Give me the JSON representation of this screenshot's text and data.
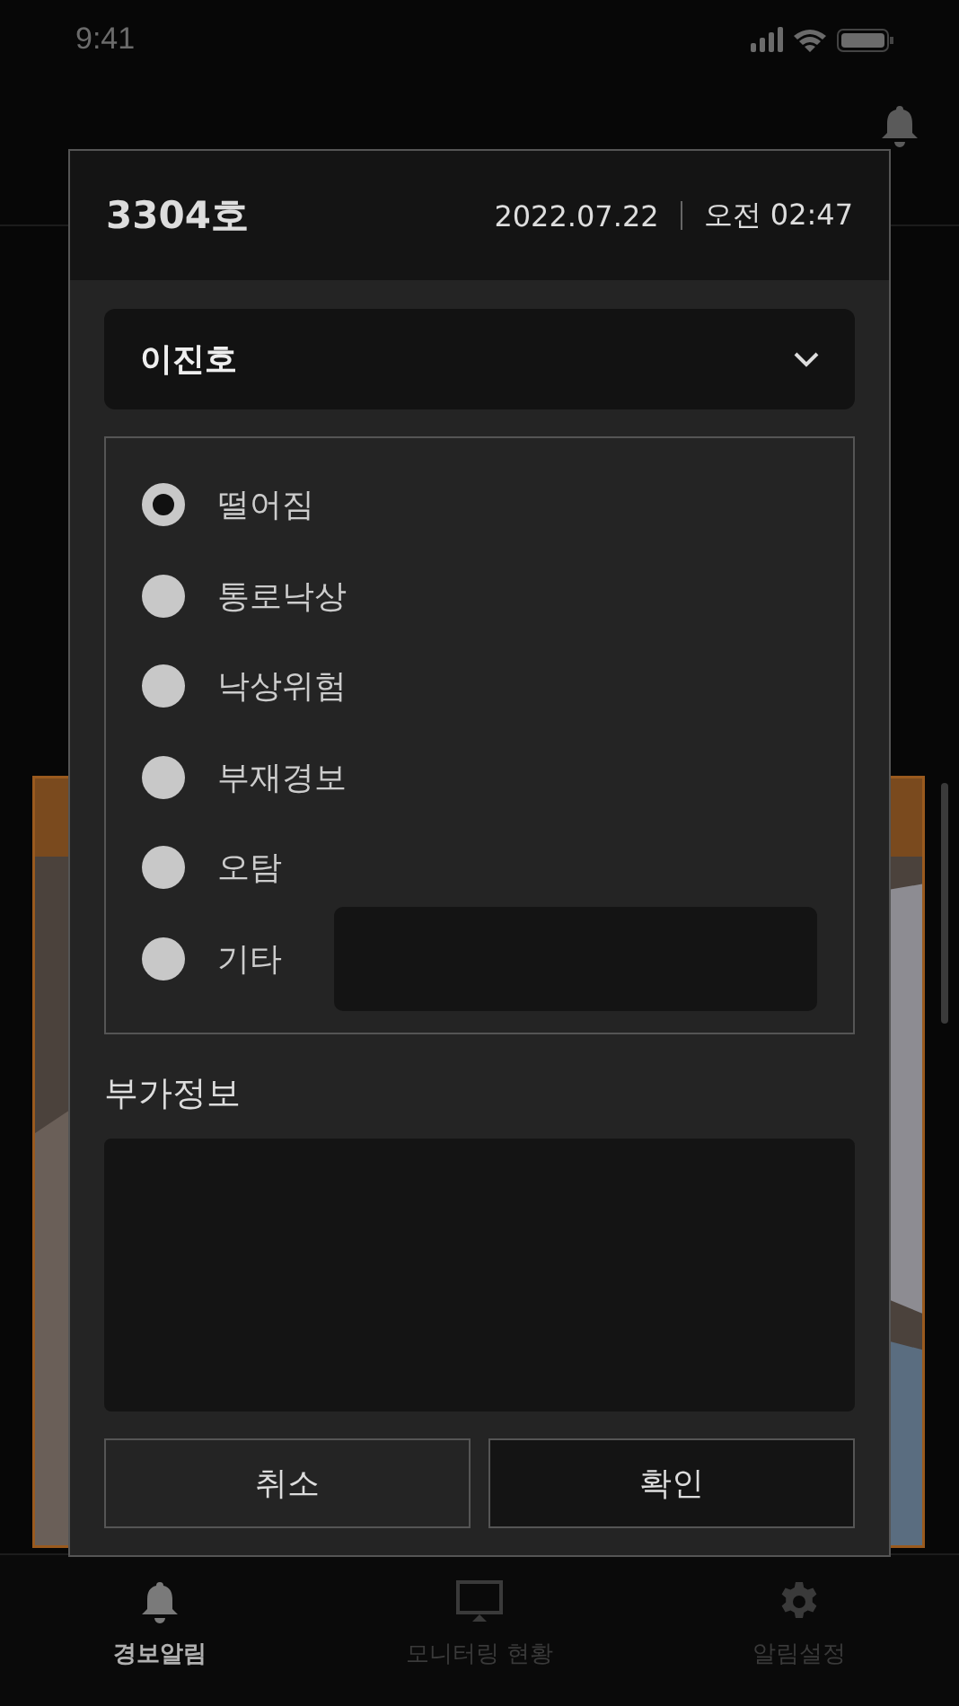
{
  "status_bar": {
    "time": "9:41"
  },
  "dialog": {
    "room": "3304호",
    "date": "2022.07.22",
    "time": "오전 02:47",
    "patient_select": {
      "value": "이진호"
    },
    "options": [
      {
        "label": "떨어짐",
        "selected": true
      },
      {
        "label": "통로낙상",
        "selected": false
      },
      {
        "label": "낙상위험",
        "selected": false
      },
      {
        "label": "부재경보",
        "selected": false
      },
      {
        "label": "오탐",
        "selected": false
      },
      {
        "label": "기타",
        "selected": false,
        "kind": "with_input"
      }
    ],
    "extra_info_label": "부가정보",
    "buttons": [
      {
        "label": "취소",
        "kind": "secondary"
      },
      {
        "label": "확인",
        "kind": "primary"
      }
    ]
  },
  "tab_bar": [
    {
      "label": "경보알림",
      "selected": true
    },
    {
      "label": "모니터링 현황",
      "selected": false
    },
    {
      "label": "알림설정",
      "selected": false
    }
  ]
}
